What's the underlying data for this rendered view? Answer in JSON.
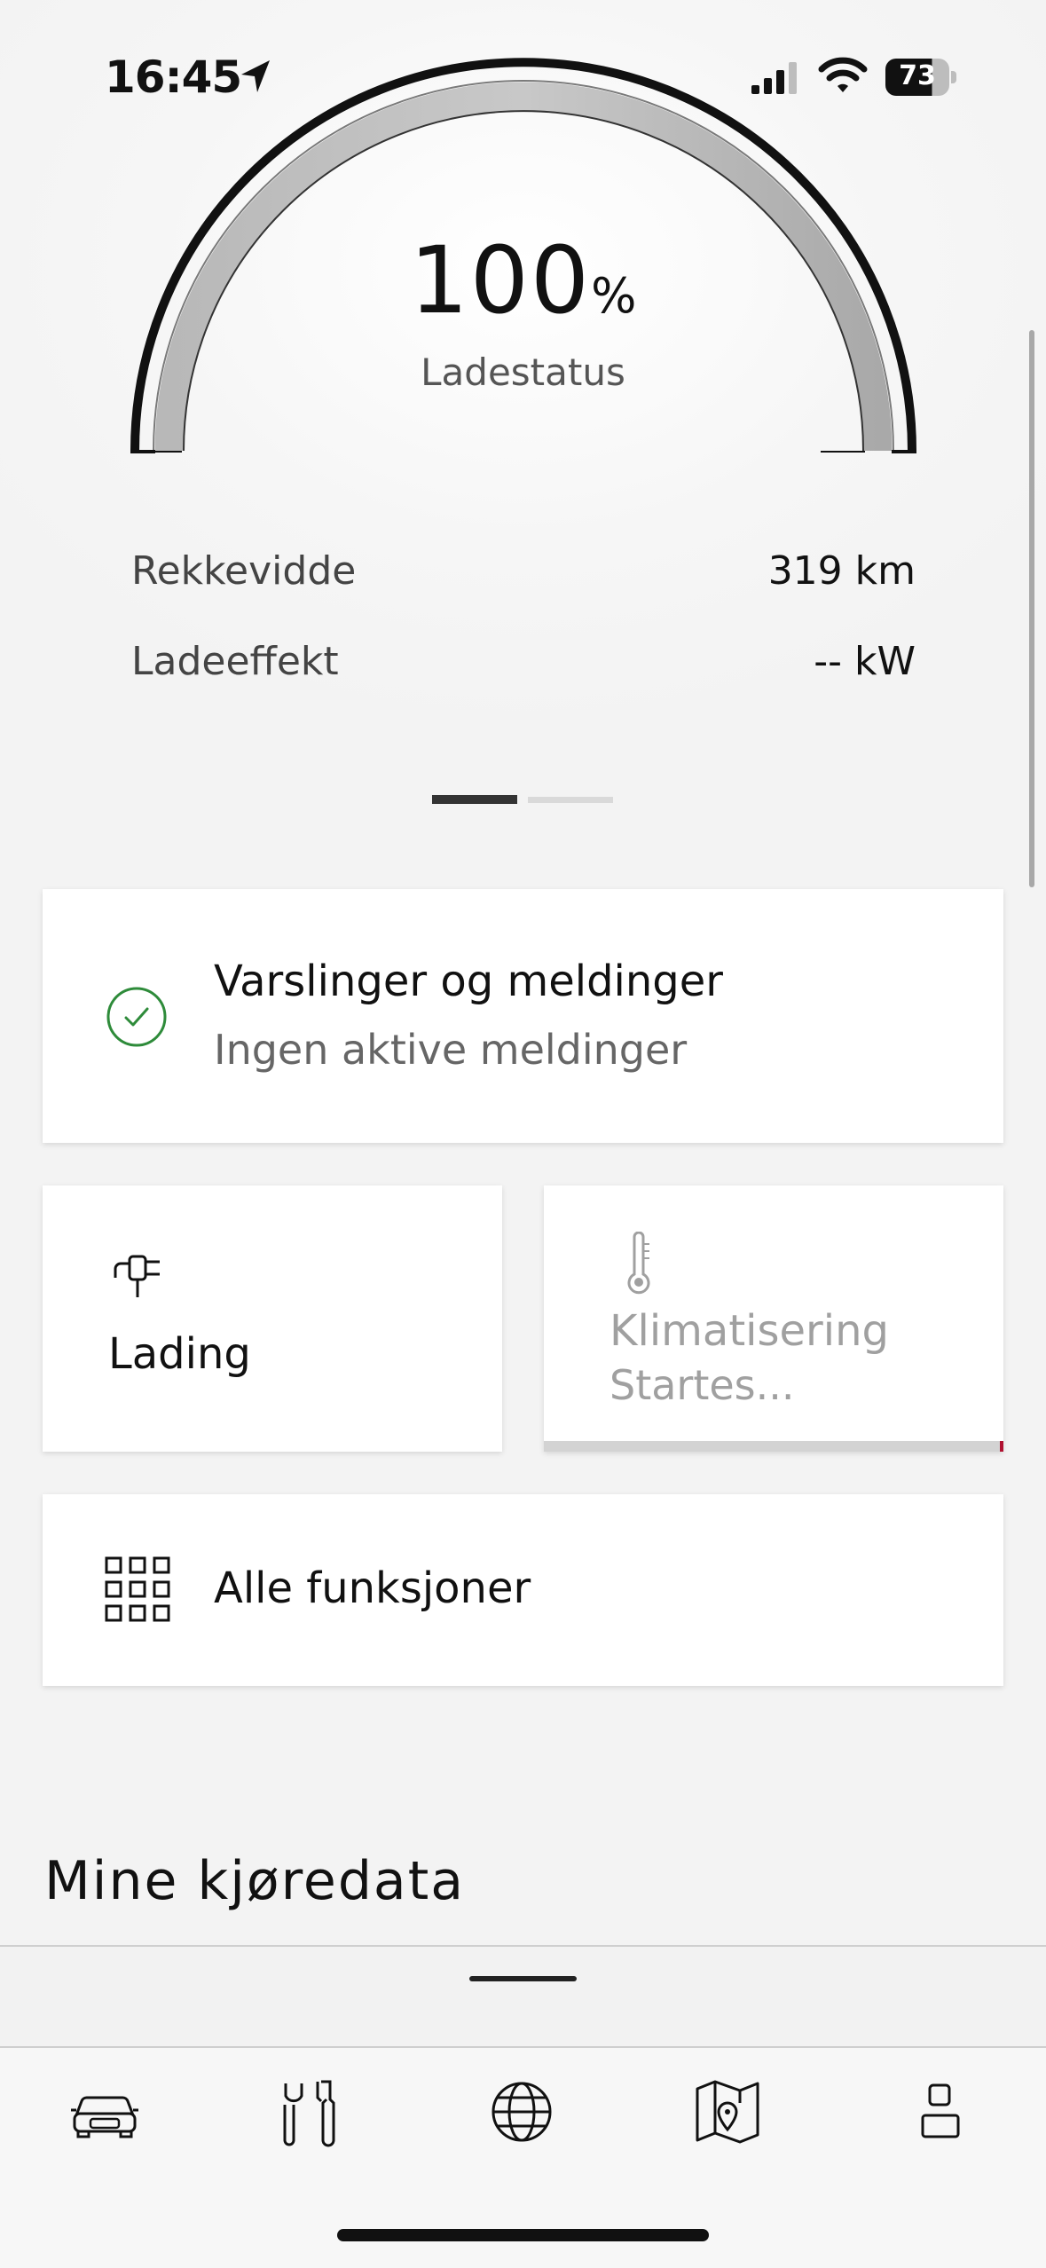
{
  "status_bar": {
    "time": "16:45",
    "battery_level": "73",
    "icons": [
      "location-arrow-icon",
      "cellular-signal-icon",
      "wifi-icon",
      "battery-icon"
    ]
  },
  "gauge": {
    "value": "100",
    "unit": "%",
    "label": "Ladestatus",
    "fill_fraction": 1.0
  },
  "info": {
    "range_label": "Rekkevidde",
    "range_value": "319 km",
    "power_label": "Ladeeffekt",
    "power_value": "-- kW"
  },
  "pager": {
    "pages": 2,
    "active": 1
  },
  "notifications_card": {
    "title": "Varslinger og meldinger",
    "subtitle": "Ingen aktive meldinger",
    "icon": "check-circle-icon",
    "status_color": "#2e8b3a"
  },
  "charging_card": {
    "label": "Lading",
    "icon": "plug-icon"
  },
  "climate_card": {
    "title": "Klimatisering",
    "status": "Startes...",
    "icon": "thermometer-icon",
    "accent_color": "#b01030"
  },
  "all_functions_card": {
    "label": "Alle funksjoner",
    "icon": "grid-icon"
  },
  "section": {
    "title": "Mine kjøredata"
  },
  "bottom_nav": {
    "items": [
      {
        "name": "car",
        "icon": "car-icon"
      },
      {
        "name": "service",
        "icon": "tools-icon"
      },
      {
        "name": "globe",
        "icon": "globe-icon"
      },
      {
        "name": "map",
        "icon": "map-pin-icon"
      },
      {
        "name": "profile",
        "icon": "user-icon"
      }
    ]
  }
}
